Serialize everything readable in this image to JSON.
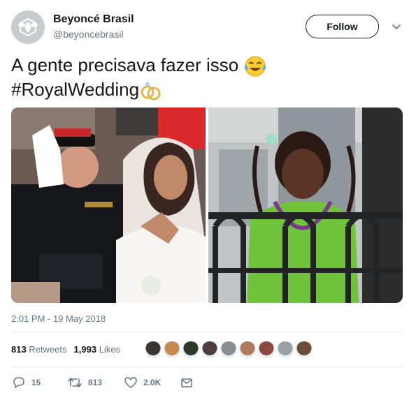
{
  "account": {
    "name": "Beyoncé Brasil",
    "handle": "@beyoncebrasil",
    "avatar_icon": "bee-logo-icon"
  },
  "follow_label": "Follow",
  "more_icon": "chevron-down-icon",
  "tweet": {
    "line1": "A gente precisava fazer isso",
    "line1_emoji": "face-with-tears-of-joy-icon",
    "line2": "#RoyalWedding",
    "line2_emoji": "rings-icon"
  },
  "media": {
    "left_image": "royal-wedding-photo",
    "right_image": "girl-on-balcony-photo"
  },
  "timestamp": "2:01 PM - 19 May 2018",
  "stats": {
    "retweets_count": "813",
    "retweets_label": "Retweets",
    "likes_count": "1,993",
    "likes_label": "Likes"
  },
  "liker_avatar_colors": [
    "#3a3530",
    "#c58a52",
    "#2c3a2b",
    "#4a3f3a",
    "#8a8e92",
    "#b07b5a",
    "#8c4a3f",
    "#9aa0a6",
    "#6b4a36"
  ],
  "actions": {
    "reply_count": "15",
    "retweet_count": "813",
    "like_count": "2.0K"
  },
  "colors": {
    "text": "#14171a",
    "secondary": "#657786",
    "divider": "#e6ecf0"
  }
}
